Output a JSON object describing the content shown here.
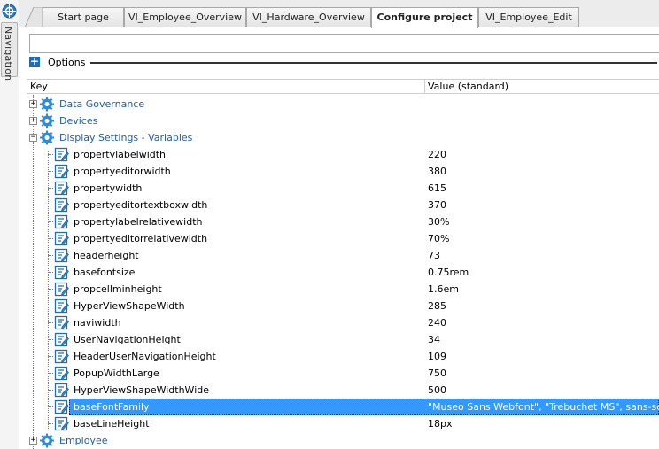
{
  "navigation": {
    "label": "Navigation",
    "icon": "navigation-globe-icon"
  },
  "tabs": [
    {
      "label": "Start page",
      "active": false
    },
    {
      "label": "VI_Employee_Overview",
      "active": false
    },
    {
      "label": "VI_Hardware_Overview",
      "active": false
    },
    {
      "label": "Configure project",
      "active": true
    },
    {
      "label": "VI_Employee_Edit",
      "active": false
    }
  ],
  "search": {
    "value": ""
  },
  "options": {
    "label": "Options"
  },
  "columns": {
    "key": "Key",
    "value": "Value (standard)"
  },
  "tree": {
    "categories_top": [
      {
        "label": "Data Governance",
        "expanded": false
      },
      {
        "label": "Devices",
        "expanded": false
      },
      {
        "label": "Display Settings - Variables",
        "expanded": true
      }
    ],
    "items": [
      {
        "key": "propertylabelwidth",
        "value": "220"
      },
      {
        "key": "propertyeditorwidth",
        "value": "380"
      },
      {
        "key": "propertywidth",
        "value": "615"
      },
      {
        "key": "propertyeditortextboxwidth",
        "value": "370"
      },
      {
        "key": "propertylabelrelativewidth",
        "value": "30%"
      },
      {
        "key": "propertyeditorrelativewidth",
        "value": "70%"
      },
      {
        "key": "headerheight",
        "value": "73"
      },
      {
        "key": "basefontsize",
        "value": "0.75rem"
      },
      {
        "key": "propcellminheight",
        "value": "1.6em"
      },
      {
        "key": "HyperViewShapeWidth",
        "value": "285"
      },
      {
        "key": "naviwidth",
        "value": "240"
      },
      {
        "key": "UserNavigationHeight",
        "value": "34"
      },
      {
        "key": "HeaderUserNavigationHeight",
        "value": "109"
      },
      {
        "key": "PopupWidthLarge",
        "value": "750"
      },
      {
        "key": "HyperViewShapeWidthWide",
        "value": "500"
      },
      {
        "key": "baseFontFamily",
        "value": "\"Museo Sans Webfont\", \"Trebuchet MS\", sans-serif",
        "selected": true
      },
      {
        "key": "baseLineHeight",
        "value": "18px"
      }
    ],
    "categories_bottom": [
      {
        "label": "Employee",
        "expanded": false
      }
    ]
  },
  "colors": {
    "accent": "#1c6fb7",
    "selection": "#3399ff",
    "category_text": "#1f5fa8"
  }
}
